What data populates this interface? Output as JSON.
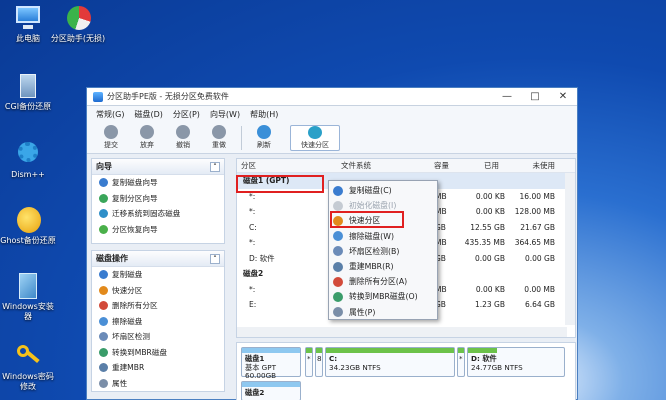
{
  "desktop": [
    {
      "label": "此电脑"
    },
    {
      "label": "分区助手(无损)"
    },
    {
      "label": "CGI备份还原"
    },
    {
      "label": "Dism++"
    },
    {
      "label": "Ghost备份还原"
    },
    {
      "label": "Windows安装器"
    },
    {
      "label": "Windows密码修改"
    }
  ],
  "window": {
    "title": "分区助手PE版 - 无损分区免费软件",
    "menu": [
      "常规(G)",
      "磁盘(D)",
      "分区(P)",
      "向导(W)",
      "帮助(H)"
    ],
    "toolbar": [
      {
        "label": "提交",
        "color": "#8a97a8"
      },
      {
        "label": "放弃",
        "color": "#8a97a8"
      },
      {
        "label": "撤销",
        "color": "#8a97a8"
      },
      {
        "label": "重做",
        "color": "#8a97a8"
      },
      {
        "label": "刷新",
        "color": "#3a8fd8"
      },
      {
        "label": "快速分区",
        "color": "#2aa0c8"
      }
    ]
  },
  "wizard": {
    "title": "向导",
    "items": [
      "复制磁盘向导",
      "复制分区向导",
      "迁移系统到固态磁盘",
      "分区恢复向导"
    ]
  },
  "disk_ops": {
    "title": "磁盘操作",
    "items": [
      "复制磁盘",
      "快速分区",
      "删除所有分区",
      "擦除磁盘",
      "坏扇区检测",
      "转换到MBR磁盘",
      "重建MBR",
      "属性"
    ]
  },
  "table": {
    "headers": [
      "分区",
      "文件系统",
      "容量",
      "已用",
      "未使用"
    ],
    "disk1": "磁盘1 (GPT)",
    "disk2": "磁盘2",
    "rows": [
      {
        "name": "*:",
        "cap": "MB",
        "used": "0.00 KB",
        "free": "16.00 MB"
      },
      {
        "name": "*:",
        "cap": "MB",
        "used": "0.00 KB",
        "free": "128.00 MB"
      },
      {
        "name": "C:",
        "cap": "GB",
        "used": "12.55 GB",
        "free": "21.67 GB"
      },
      {
        "name": "*:",
        "cap": "MB",
        "used": "435.35 MB",
        "free": "364.65 MB"
      },
      {
        "name": "D: 软件",
        "cap": "GB",
        "used": "0.00 GB",
        "free": "0.00 GB"
      },
      {
        "name": "*:",
        "cap": "MB",
        "used": "0.00 KB",
        "free": "0.00 MB"
      },
      {
        "name": "E:",
        "cap": "GB",
        "used": "1.23 GB",
        "free": "6.64 GB"
      }
    ]
  },
  "map": {
    "disk1_name": "磁盘1",
    "disk1_type": "基本 GPT",
    "disk1_size": "60.00GB",
    "c_label": "C:",
    "c_info": "34.23GB NTFS",
    "d_label": "D: 软件",
    "d_info": "24.77GB NTFS",
    "disk2_name": "磁盘2",
    "small_labels": [
      "*",
      "8",
      "*"
    ]
  },
  "context_menu": {
    "items": [
      {
        "label": "复制磁盘(C)",
        "disabled": false,
        "color": "#3a7ccf"
      },
      {
        "label": "初始化磁盘(I)",
        "disabled": true,
        "color": "#c5cbd3"
      },
      {
        "label": "快速分区",
        "disabled": false,
        "color": "#e28a1c"
      },
      {
        "label": "擦除磁盘(W)",
        "disabled": false,
        "color": "#4a8fd6"
      },
      {
        "label": "坏扇区检测(B)",
        "disabled": false,
        "color": "#6b8bb8"
      },
      {
        "label": "重建MBR(R)",
        "disabled": false,
        "color": "#5a7fa8"
      },
      {
        "label": "删除所有分区(A)",
        "disabled": false,
        "color": "#d24a3a"
      },
      {
        "label": "转换到MBR磁盘(O)",
        "disabled": false,
        "color": "#3a9c6a"
      },
      {
        "label": "属性(P)",
        "disabled": false,
        "color": "#7a8ea8"
      }
    ]
  }
}
